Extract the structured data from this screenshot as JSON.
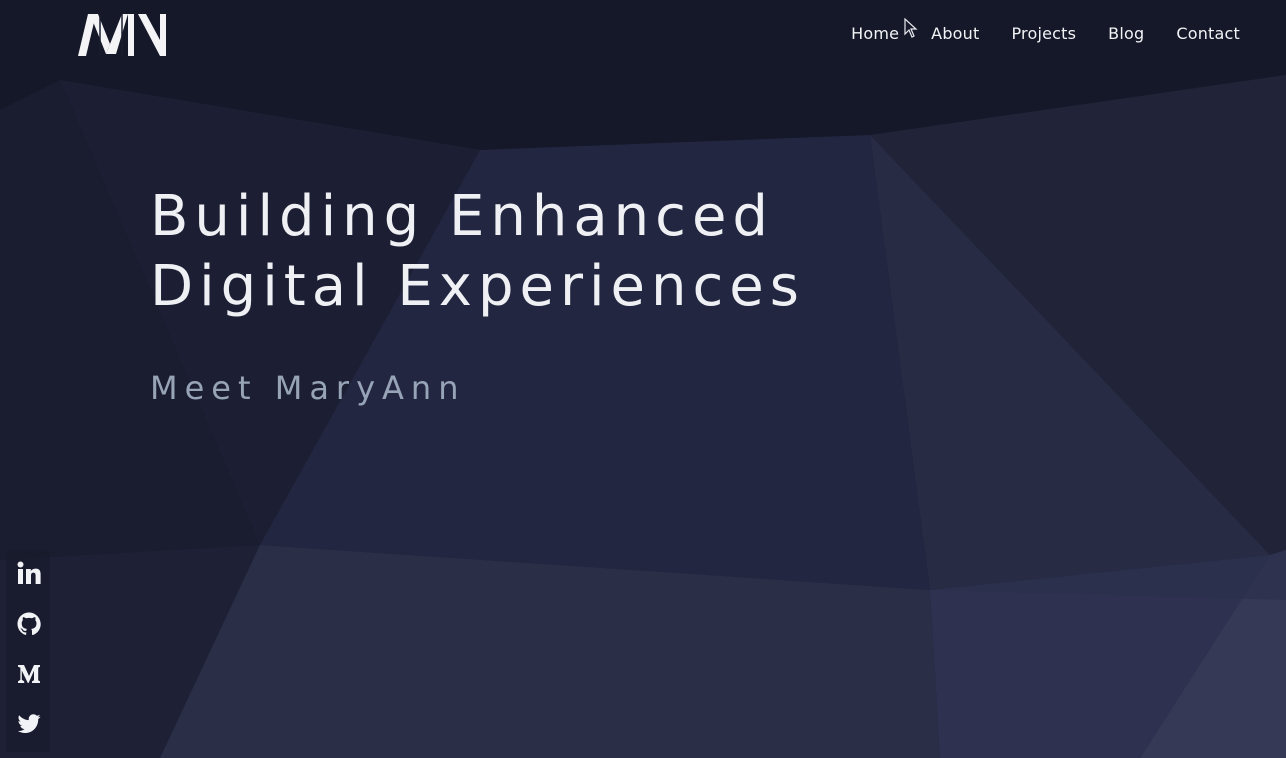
{
  "header": {
    "logo_text": "MN",
    "nav": [
      "Home",
      "About",
      "Projects",
      "Blog",
      "Contact"
    ]
  },
  "hero": {
    "title_line1": "Building Enhanced",
    "title_line2": "Digital Experiences",
    "subtitle": "Meet MaryAnn"
  },
  "social": [
    {
      "name": "linkedin-icon"
    },
    {
      "name": "github-icon"
    },
    {
      "name": "medium-icon"
    },
    {
      "name": "twitter-icon"
    }
  ],
  "colors": {
    "background": "#181c2e",
    "text": "#eef0f4",
    "subtitle": "#97a3b6"
  }
}
